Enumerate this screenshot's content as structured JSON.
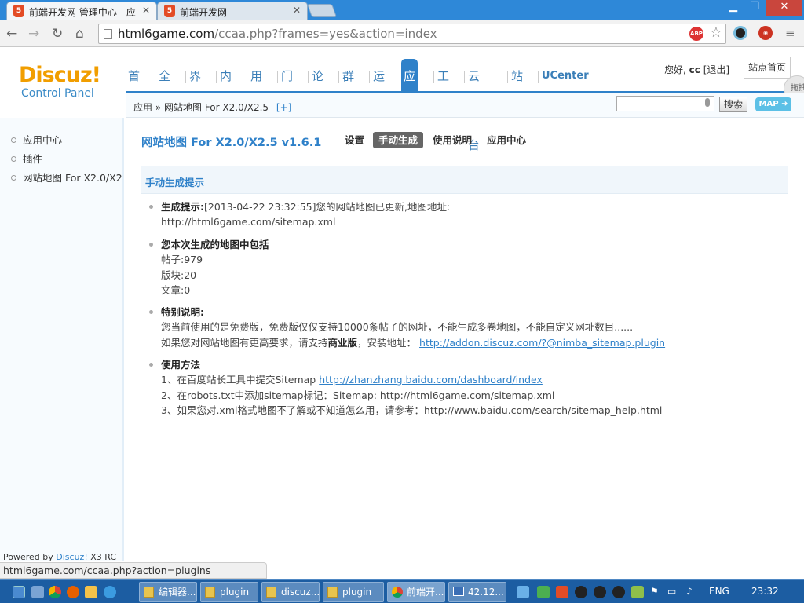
{
  "browser": {
    "tabs": [
      {
        "label": "前端开发网 管理中心 - 应",
        "active": true
      },
      {
        "label": "前端开发网",
        "active": false
      }
    ],
    "url_host": "html6game.com",
    "url_path": "/ccaa.php?frames=yes&action=index",
    "status_url": "html6game.com/ccaa.php?action=plugins"
  },
  "header": {
    "logo": "Discuz!",
    "logo_sub": "Control Panel",
    "nav": [
      "首页",
      "全局",
      "界面",
      "内容",
      "用户",
      "门户",
      "论坛",
      "群组",
      "运营",
      "应用",
      "工具",
      "云平台",
      "站长",
      "UCenter"
    ],
    "active_nav": "应用",
    "greeting": "您好,",
    "username": "cc",
    "logout": "[退出]",
    "site_home": "站点首页",
    "drag_label": "拖拽"
  },
  "breadcrumb": {
    "root": "应用",
    "sep": "»",
    "current": "网站地图 For X2.0/X2.5",
    "plus": "[+]"
  },
  "search": {
    "button": "搜索",
    "map_button": "MAP"
  },
  "sidebar": {
    "items": [
      "应用中心",
      "插件",
      "网站地图 For X2.0/X2.5"
    ],
    "powered_prefix": "Powered by ",
    "powered_brand": "Discuz!",
    "powered_suffix": " X3 RC"
  },
  "main": {
    "plugin_title": "网站地图 For X2.0/X2.5 v1.6.1",
    "subtabs": [
      "设置",
      "手动生成",
      "使用说明",
      "应用中心"
    ],
    "active_subtab": "手动生成",
    "section_title": "手动生成提示",
    "gen_label": "生成提示:",
    "gen_text": "[2013-04-22 23:32:55]您的网站地图已更新,地图地址:",
    "gen_url": "http://html6game.com/sitemap.xml",
    "includes_title": "您本次生成的地图中包括",
    "threads": "帖子:979",
    "forums": "版块:20",
    "articles": "文章:0",
    "note_title": "特别说明:",
    "note_line1": "您当前使用的是免费版，免费版仅仅支持10000条帖子的网址，不能生成多卷地图，不能自定义网址数目......",
    "note_line2_prefix": "如果您对网站地图有更高要求，请支持",
    "note_line2_bold": "商业版",
    "note_line2_mid": "，安装地址：",
    "note_link": "http://addon.discuz.com/?@nimba_sitemap.plugin",
    "usage_title": "使用方法",
    "usage1_prefix": "1、在百度站长工具中提交Sitemap ",
    "usage1_link": "http://zhanzhang.baidu.com/dashboard/index",
    "usage2": "2、在robots.txt中添加sitemap标记：Sitemap: http://html6game.com/sitemap.xml",
    "usage3": "3、如果您对.xml格式地图不了解或不知道怎么用，请参考：http://www.baidu.com/search/sitemap_help.html"
  },
  "taskbar": {
    "tasks": [
      "编辑器...",
      "plugin",
      "discuz...",
      "plugin",
      "前端开...",
      "42.12..."
    ],
    "lang": "ENG",
    "time": "23:32"
  },
  "colors": {
    "accent": "#2f81c9",
    "logo": "#f19e00",
    "taskbar": "#1c5da2"
  }
}
